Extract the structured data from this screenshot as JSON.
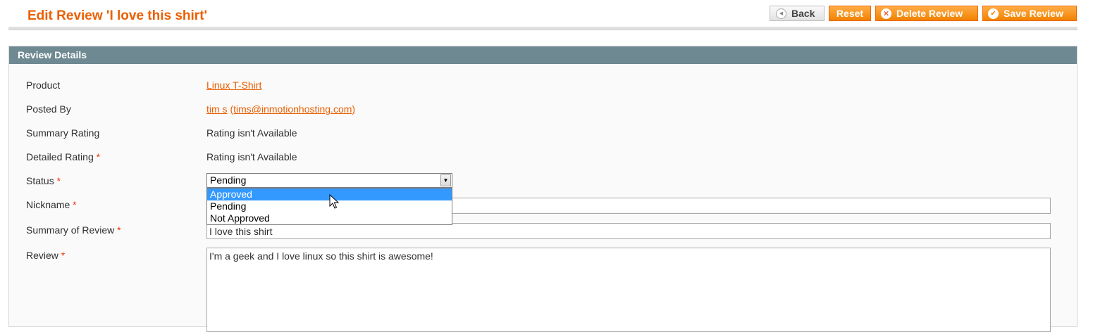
{
  "page": {
    "title": "Edit Review 'I love this shirt'"
  },
  "toolbar": {
    "back_label": "Back",
    "reset_label": "Reset",
    "delete_label": "Delete Review",
    "save_label": "Save Review",
    "back_icon": "back-arrow-icon",
    "delete_icon": "delete-circle-icon",
    "save_icon": "checkmark-circle-icon",
    "accent_color": "#eb5e00"
  },
  "panel": {
    "title": "Review Details"
  },
  "fields": {
    "product": {
      "label": "Product",
      "value": "Linux T-Shirt"
    },
    "posted_by": {
      "label": "Posted By",
      "name": "tim s",
      "email": "(tims@inmotionhosting.com)"
    },
    "summary_rating": {
      "label": "Summary Rating",
      "value": "Rating isn't Available"
    },
    "detailed_rating": {
      "label": "Detailed Rating",
      "required": "*",
      "value": "Rating isn't Available"
    },
    "status": {
      "label": "Status",
      "required": "*",
      "value": "Pending",
      "options": [
        "Approved",
        "Pending",
        "Not Approved"
      ],
      "highlighted": "Approved"
    },
    "nickname": {
      "label": "Nickname",
      "required": "*",
      "value": ""
    },
    "summary_of_review": {
      "label": "Summary of Review",
      "required": "*",
      "value": "I love this shirt"
    },
    "review": {
      "label": "Review",
      "required": "*",
      "value": "I'm a geek and I love linux so this shirt is awesome!"
    }
  }
}
